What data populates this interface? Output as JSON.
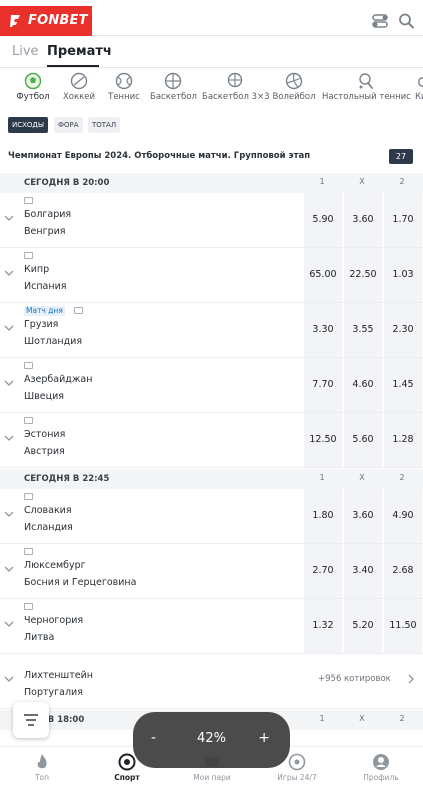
{
  "brand": {
    "name": "FONBET",
    "accent": "#e9302a"
  },
  "top_icons": [
    "toggle-icon",
    "search-icon"
  ],
  "tabs": [
    {
      "label": "Live",
      "active": false
    },
    {
      "label": "Прематч",
      "active": true
    }
  ],
  "sports": [
    {
      "label": "Футбол",
      "icon": "football-icon",
      "active": true
    },
    {
      "label": "Хоккей",
      "icon": "hockey-puck-icon",
      "active": false
    },
    {
      "label": "Теннис",
      "icon": "tennis-ball-icon",
      "active": false
    },
    {
      "label": "Баскетбол",
      "icon": "basketball-icon",
      "active": false
    },
    {
      "label": "Баскетбол 3×3",
      "icon": "basketball-3x3-icon",
      "active": false
    },
    {
      "label": "Волейбол",
      "icon": "volleyball-icon",
      "active": false
    },
    {
      "label": "Настольный теннис",
      "icon": "table-tennis-icon",
      "active": false
    },
    {
      "label": "Кибе",
      "icon": "esports-icon",
      "active": false
    }
  ],
  "filters": [
    {
      "label": "ИСХОДЫ",
      "active": true
    },
    {
      "label": "ФОРА",
      "active": false
    },
    {
      "label": "ТОТАЛ",
      "active": false
    }
  ],
  "league": {
    "name": "Чемпионат Европы 2024. Отборочные матчи. Групповой этап",
    "count": "27"
  },
  "columns": [
    "1",
    "X",
    "2"
  ],
  "sections": [
    {
      "title": "СЕГОДНЯ В 20:00",
      "matches": [
        {
          "team1": "Болгария",
          "team2": "Венгрия",
          "odds": [
            "5.90",
            "3.60",
            "1.70"
          ]
        },
        {
          "team1": "Кипр",
          "team2": "Испания",
          "odds": [
            "65.00",
            "22.50",
            "1.03"
          ]
        },
        {
          "team1": "Грузия",
          "team2": "Шотландия",
          "badge": "Матч дня",
          "odds": [
            "3.30",
            "3.55",
            "2.30"
          ]
        },
        {
          "team1": "Азербайджан",
          "team2": "Швеция",
          "odds": [
            "7.70",
            "4.60",
            "1.45"
          ]
        },
        {
          "team1": "Эстония",
          "team2": "Австрия",
          "odds": [
            "12.50",
            "5.60",
            "1.28"
          ]
        }
      ]
    },
    {
      "title": "СЕГОДНЯ В 22:45",
      "matches": [
        {
          "team1": "Словакия",
          "team2": "Исландия",
          "odds": [
            "1.80",
            "3.60",
            "4.90"
          ]
        },
        {
          "team1": "Люксембург",
          "team2": "Босния и Герцеговина",
          "odds": [
            "2.70",
            "3.40",
            "2.68"
          ]
        },
        {
          "team1": "Черногория",
          "team2": "Литва",
          "odds": [
            "1.32",
            "5.20",
            "11.50"
          ]
        },
        {
          "team1": "Лихтенштейн",
          "team2": "Португалия",
          "quotes": "+956 котировок"
        }
      ]
    },
    {
      "title": "РА В 18:00"
    }
  ],
  "zoom": {
    "minus": "-",
    "value": "42%",
    "plus": "+"
  },
  "bottom_nav": [
    {
      "label": "Топ",
      "icon": "flame-icon",
      "active": false
    },
    {
      "label": "Спорт",
      "icon": "sport-target-icon",
      "active": true
    },
    {
      "label": "Мои пари",
      "icon": "ticket-icon",
      "active": false
    },
    {
      "label": "Игры 24/7",
      "icon": "games-icon",
      "active": false
    },
    {
      "label": "Профиль",
      "icon": "profile-icon",
      "active": false
    }
  ]
}
